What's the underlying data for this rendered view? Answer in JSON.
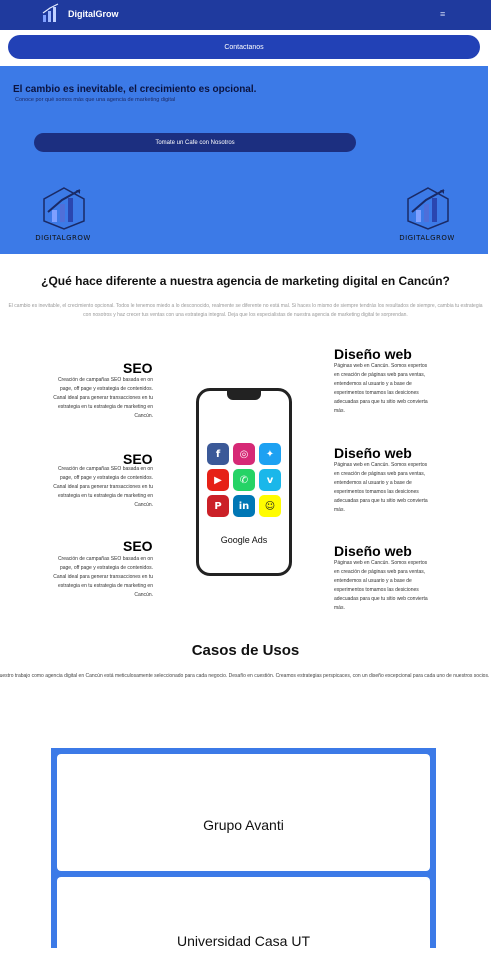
{
  "header": {
    "brand": "DigitalGrow",
    "menu_icon": "hamburger-icon",
    "contact_button": "Contactanos"
  },
  "hero": {
    "title": "El cambio es inevitable, el crecimiento es opcional.",
    "subtitle": "Conoce por qué somos más que una agencia de marketing digital",
    "cta": "Tomate un Cafe con Nosotros",
    "logo_text": "DIGITALGROW"
  },
  "intro": {
    "title": "¿Qué hace diferente a nuestra agencia de marketing digital en Cancún?",
    "paragraph": "El cambio es inevitable, el crecimiento opcional. Todos le tenemos miedo a lo desconocido, realmente se diferente no está mal. Si haces lo mismo de siempre tendrás los resultados de siempre, cambia tu estrategia con nosotros y haz crecer tus ventas con una estrategia integral. Deja que los especialistas de nuestra agencia de marketing digital te sorprendan."
  },
  "services_left": [
    {
      "title": "SEO",
      "desc": "Creación de campañas SEO basada en on page, off page y estrategia de contenidos. Canal ideal para generar transacciones en tu estrategia en tu estrategia de marketing en Cancún."
    },
    {
      "title": "SEO",
      "desc": "Creación de campañas SEO basada en on page, off page y estrategia de contenidos. Canal ideal para generar transacciones en tu estrategia en tu estrategia de marketing en Cancún."
    },
    {
      "title": "SEO",
      "desc": "Creación de campañas SEO basada en on page, off page y estrategia de contenidos. Canal ideal para generar transacciones en tu estrategia en tu estrategia de marketing en Cancún."
    }
  ],
  "services_right": [
    {
      "title": "Diseño web",
      "desc": "Páginas web en Cancún. Somos expertos en creación de páginas web para ventas, entendemos al usuario y a base de experimentos tomamos las desiciones adecuadas para que tu sitio web convierta más."
    },
    {
      "title": "Diseño web",
      "desc": "Páginas web en Cancún. Somos expertos en creación de páginas web para ventas, entendemos al usuario y a base de experimentos tomamos las desiciones adecuadas para que tu sitio web convierta más."
    },
    {
      "title": "Diseño web",
      "desc": "Páginas web en Cancún. Somos expertos en creación de páginas web para ventas, entendemos al usuario y a base de experimentos tomamos las desiciones adecuadas para que tu sitio web convierta más."
    }
  ],
  "phone": {
    "label": "Google Ads",
    "apps": [
      {
        "icon": "facebook-icon",
        "glyph": "f",
        "color": "#3b5998"
      },
      {
        "icon": "instagram-icon",
        "glyph": "◎",
        "color": "#d62976"
      },
      {
        "icon": "twitter-icon",
        "glyph": "✦",
        "color": "#1da1f2"
      },
      {
        "icon": "youtube-icon",
        "glyph": "▶",
        "color": "#e62117"
      },
      {
        "icon": "whatsapp-icon",
        "glyph": "✆",
        "color": "#25d366"
      },
      {
        "icon": "vimeo-icon",
        "glyph": "v",
        "color": "#1ab7ea"
      },
      {
        "icon": "pinterest-icon",
        "glyph": "P",
        "color": "#cb2027"
      },
      {
        "icon": "linkedin-icon",
        "glyph": "in",
        "color": "#0077b5"
      },
      {
        "icon": "snapchat-icon",
        "glyph": "☺",
        "color": "#fffc00"
      }
    ]
  },
  "cases": {
    "title": "Casos de Usos",
    "paragraph": "Nuestro trabajo como agencia digital en Cancún está meticulosamente seleccionado para cada negocio. Desafío en cuestión. Creamos estrategias perspicaces, con un diseño excepcional para cada uno de nuestros socios.",
    "items": [
      "Grupo Avanti",
      "Universidad Casa UT"
    ]
  },
  "colors": {
    "nav": "#1f3a9e",
    "button": "#2241b6",
    "hero": "#3c7ae7",
    "cta": "#1c2f80"
  }
}
